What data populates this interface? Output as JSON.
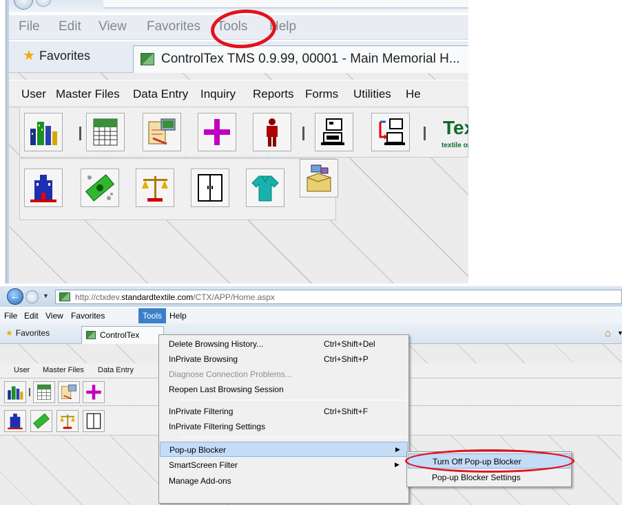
{
  "top_panel": {
    "menubar": [
      "File",
      "Edit",
      "View",
      "Favorites",
      "Tools",
      "Help"
    ],
    "favorites_label": "Favorites",
    "tab_title": "ControlTex TMS 0.9.99, 00001 - Main Memorial H...",
    "app_menu": [
      "User",
      "Master Files",
      "Data Entry",
      "Inquiry",
      "Reports",
      "Forms",
      "Utilities",
      "He"
    ],
    "logo_text": "Texk",
    "logo_sub": "textile on"
  },
  "bottom_panel": {
    "address": {
      "prefix": "http://ctxdev.",
      "domain": "standardtextile.com",
      "path": "/CTX/APP/Home.aspx"
    },
    "menubar": [
      "File",
      "Edit",
      "View",
      "Favorites",
      "Tools",
      "Help"
    ],
    "favorites_label": "Favorites",
    "tab_title": "ControlTex",
    "app_menu": [
      "User",
      "Master Files",
      "Data Entry"
    ],
    "tools_menu": [
      {
        "label": "Delete Browsing History...",
        "shortcut": "Ctrl+Shift+Del"
      },
      {
        "label": "InPrivate Browsing",
        "shortcut": "Ctrl+Shift+P"
      },
      {
        "label": "Diagnose Connection Problems...",
        "shortcut": "",
        "disabled": true
      },
      {
        "label": "Reopen Last Browsing Session",
        "shortcut": ""
      },
      {
        "label": "InPrivate Filtering",
        "shortcut": "Ctrl+Shift+F"
      },
      {
        "label": "InPrivate Filtering Settings",
        "shortcut": ""
      },
      {
        "label": "Pop-up Blocker",
        "shortcut": "",
        "submenu": true,
        "highlighted": true
      },
      {
        "label": "SmartScreen Filter",
        "shortcut": "",
        "submenu": true
      },
      {
        "label": "Manage Add-ons",
        "shortcut": ""
      }
    ],
    "popup_submenu": [
      {
        "label": "Turn Off Pop-up Blocker",
        "highlighted": true
      },
      {
        "label": "Pop-up Blocker Settings"
      }
    ]
  },
  "colors": {
    "annotation": "#e3121e",
    "menu_highlight": "#c5dcf7",
    "active_menu": "#3b80c8"
  },
  "icons": [
    "city-icon",
    "calendar-icon",
    "clipboard-computer-icon",
    "plus-icon",
    "person-icon",
    "computer-monitor-icon",
    "computer-transfer-icon",
    "building-icon",
    "money-icon",
    "scales-icon",
    "cabinet-icon",
    "scrubs-icon",
    "box-icon",
    "star-icon",
    "home-icon"
  ]
}
